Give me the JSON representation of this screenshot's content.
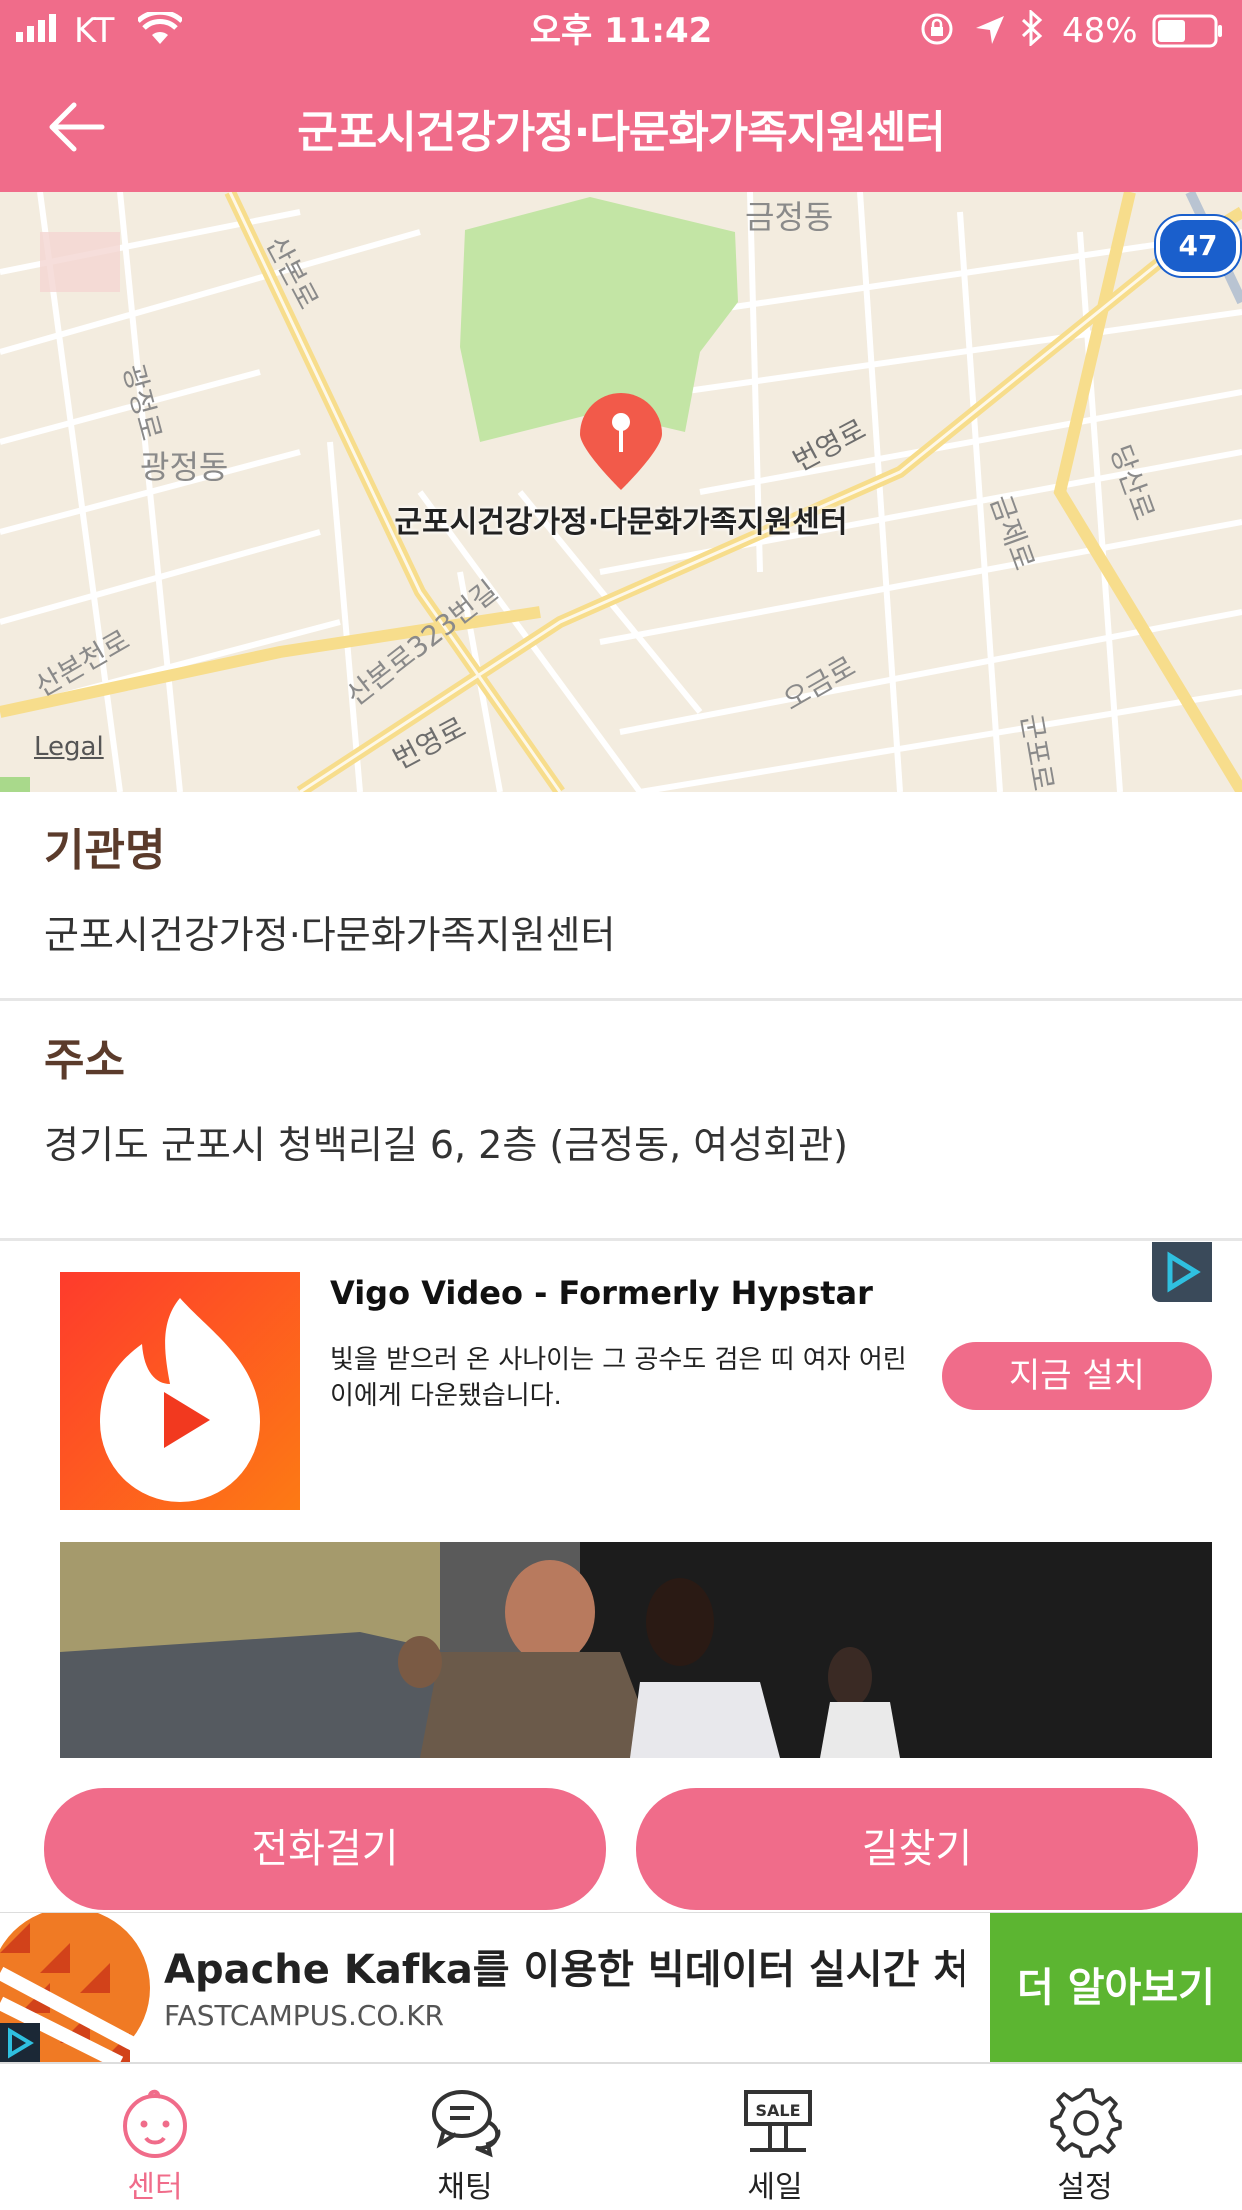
{
  "status_bar": {
    "carrier": "KT",
    "time": "오후 11:42",
    "battery": "48%"
  },
  "header": {
    "title": "군포시건강가정·다문화가족지원센터"
  },
  "map": {
    "pin_label": "군포시건강가정·다문화가족지원센터",
    "legal": "Legal",
    "route_badge": "47",
    "labels": [
      "금정동",
      "광정동",
      "산본로",
      "번영로",
      "산본천로",
      "산본로323번길",
      "번영로",
      "오금로",
      "당산로",
      "광정로",
      "금제로",
      "군포로"
    ]
  },
  "info": {
    "name_label": "기관명",
    "name_value": "군포시건강가정·다문화가족지원센터",
    "address_label": "주소",
    "address_value": "경기도 군포시 청백리길 6, 2층 (금정동, 여성회관)"
  },
  "ad": {
    "title": "Vigo Video - Formerly Hypstar",
    "description": "빛을 받으러 온 사나이는 그 공수도 검은 띠 여자 어린이에게 다운됐습니다.",
    "install_label": "지금 설치"
  },
  "actions": {
    "call_label": "전화걸기",
    "directions_label": "길찾기"
  },
  "banner": {
    "title": "Apache Kafka를 이용한 빅데이터 실시간 처...",
    "domain": "FASTCAMPUS.CO.KR",
    "cta": "더 알아보기"
  },
  "tabs": [
    {
      "label": "센터",
      "icon": "baby-face-icon",
      "active": true
    },
    {
      "label": "채팅",
      "icon": "chat-bubbles-icon",
      "active": false
    },
    {
      "label": "세일",
      "icon": "sale-sign-icon",
      "active": false
    },
    {
      "label": "설정",
      "icon": "gear-icon",
      "active": false
    }
  ],
  "colors": {
    "brand_pink": "#f06c8a",
    "banner_green": "#5cb531",
    "map_park": "#c3e5a5"
  }
}
